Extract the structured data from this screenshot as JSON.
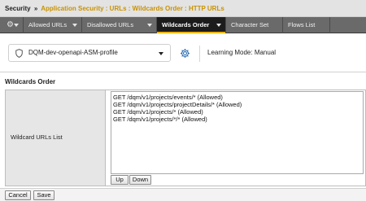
{
  "breadcrumb": {
    "root": "Security",
    "separator": "»",
    "path": "Application Security : URLs : Wildcards Order : HTTP URLs"
  },
  "tabs": [
    {
      "label": "",
      "icon": "gear-icon",
      "has_menu": true
    },
    {
      "label": "Allowed URLs",
      "has_menu": true
    },
    {
      "label": "Disallowed URLs",
      "has_menu": true
    },
    {
      "label": "Wildcards Order",
      "has_menu": true,
      "active": true
    },
    {
      "label": "Character Set",
      "has_menu": false
    },
    {
      "label": "Flows List",
      "has_menu": false
    }
  ],
  "profile": {
    "name": "DQM-dev-openapi-ASM-profile",
    "learning_mode": "Learning Mode: Manual"
  },
  "section": {
    "title": "Wildcards Order"
  },
  "wildcard_list": {
    "label": "Wildcard URLs List",
    "items": [
      "GET /dqm/v1/projects/events/* (Allowed)",
      "GET /dqm/v1/projects/projectDetails/* (Allowed)",
      "GET /dqm/v1/projects/* (Allowed)",
      "GET /dqm/v1/projects/*/* (Allowed)"
    ],
    "up_label": "Up",
    "down_label": "Down"
  },
  "actions": {
    "cancel_label": "Cancel",
    "save_label": "Save"
  },
  "colors": {
    "accent": "#f4b400",
    "breadcrumb_path": "#c99200",
    "tabbar_bg": "#6a6a6a",
    "active_tab_bg": "#1c1c1c",
    "profile_icon": "#2b6cb0"
  }
}
